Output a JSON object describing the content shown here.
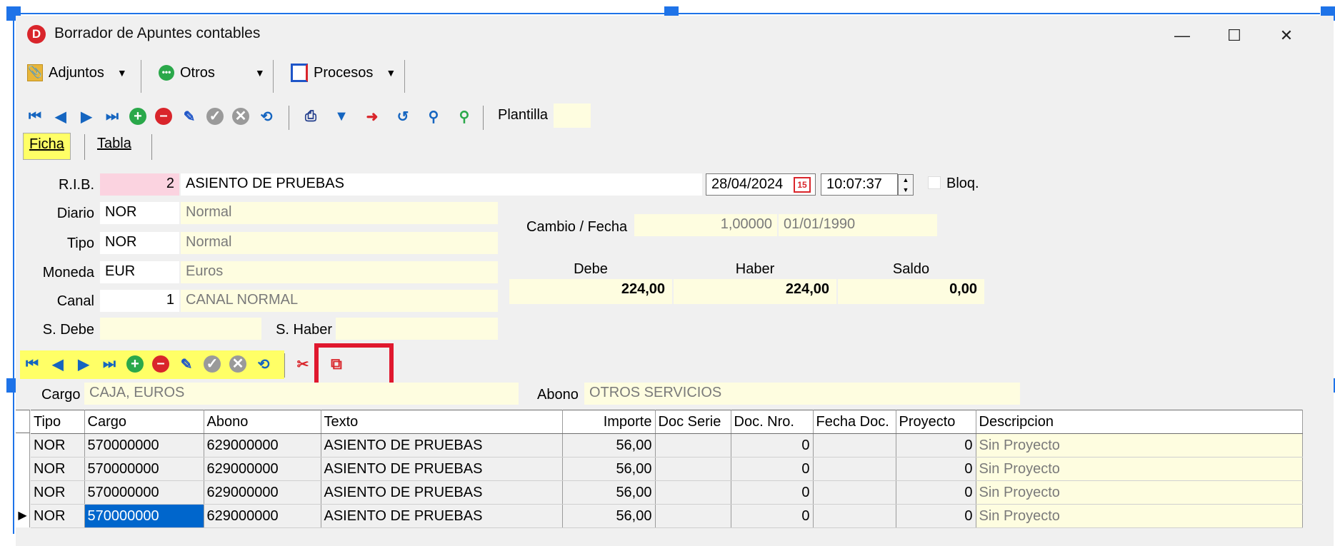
{
  "window": {
    "title": "Borrador de Apuntes contables"
  },
  "menubar": {
    "adjuntos": "Adjuntos",
    "otros": "Otros",
    "procesos": "Procesos"
  },
  "toolbar": {
    "plantilla_label": "Plantilla",
    "plantilla_value": ""
  },
  "tabs": {
    "ficha": "Ficha",
    "tabla": "Tabla"
  },
  "header": {
    "rib_label": "R.I.B.",
    "rib_value": "2",
    "rib_desc": "ASIENTO  DE PRUEBAS",
    "date": "28/04/2024",
    "time": "10:07:37",
    "bloq_label": "Bloq.",
    "diario_label": "Diario",
    "diario_code": "NOR",
    "diario_desc": "Normal",
    "tipo_label": "Tipo",
    "tipo_code": "NOR",
    "tipo_desc": "Normal",
    "moneda_label": "Moneda",
    "moneda_code": "EUR",
    "moneda_desc": "Euros",
    "canal_label": "Canal",
    "canal_code": "1",
    "canal_desc": "CANAL NORMAL",
    "sdebe_label": "S. Debe",
    "shaber_label": "S. Haber",
    "cambio_label": "Cambio / Fecha",
    "cambio_value": "1,00000",
    "cambio_fecha": "01/01/1990",
    "debe_label": "Debe",
    "haber_label": "Haber",
    "saldo_label": "Saldo",
    "debe_value": "224,00",
    "haber_value": "224,00",
    "saldo_value": "0,00"
  },
  "detail": {
    "cargo_label": "Cargo",
    "cargo_value": "CAJA, EUROS",
    "abono_label": "Abono",
    "abono_value": "OTROS SERVICIOS"
  },
  "grid": {
    "columns": [
      "Tipo",
      "Cargo",
      "Abono",
      "Texto",
      "Importe",
      "Doc Serie",
      "Doc. Nro.",
      "Fecha Doc.",
      "Proyecto",
      "Descripcion"
    ],
    "rows": [
      [
        "NOR",
        "570000000",
        "629000000",
        "ASIENTO  DE PRUEBAS",
        "56,00",
        "",
        "0",
        "",
        "0",
        "Sin Proyecto"
      ],
      [
        "NOR",
        "570000000",
        "629000000",
        "ASIENTO  DE PRUEBAS",
        "56,00",
        "",
        "0",
        "",
        "0",
        "Sin Proyecto"
      ],
      [
        "NOR",
        "570000000",
        "629000000",
        "ASIENTO  DE PRUEBAS",
        "56,00",
        "",
        "0",
        "",
        "0",
        "Sin Proyecto"
      ],
      [
        "NOR",
        "570000000",
        "629000000",
        "ASIENTO  DE PRUEBAS",
        "56,00",
        "",
        "0",
        "",
        "0",
        "Sin Proyecto"
      ]
    ]
  },
  "colors": {
    "highlight_red": "#e0182e",
    "nav_blue": "#1565c0",
    "toolbar_yellow": "#ffff66",
    "field_yellow": "#fefde0",
    "selection_blue": "#0066cc"
  }
}
